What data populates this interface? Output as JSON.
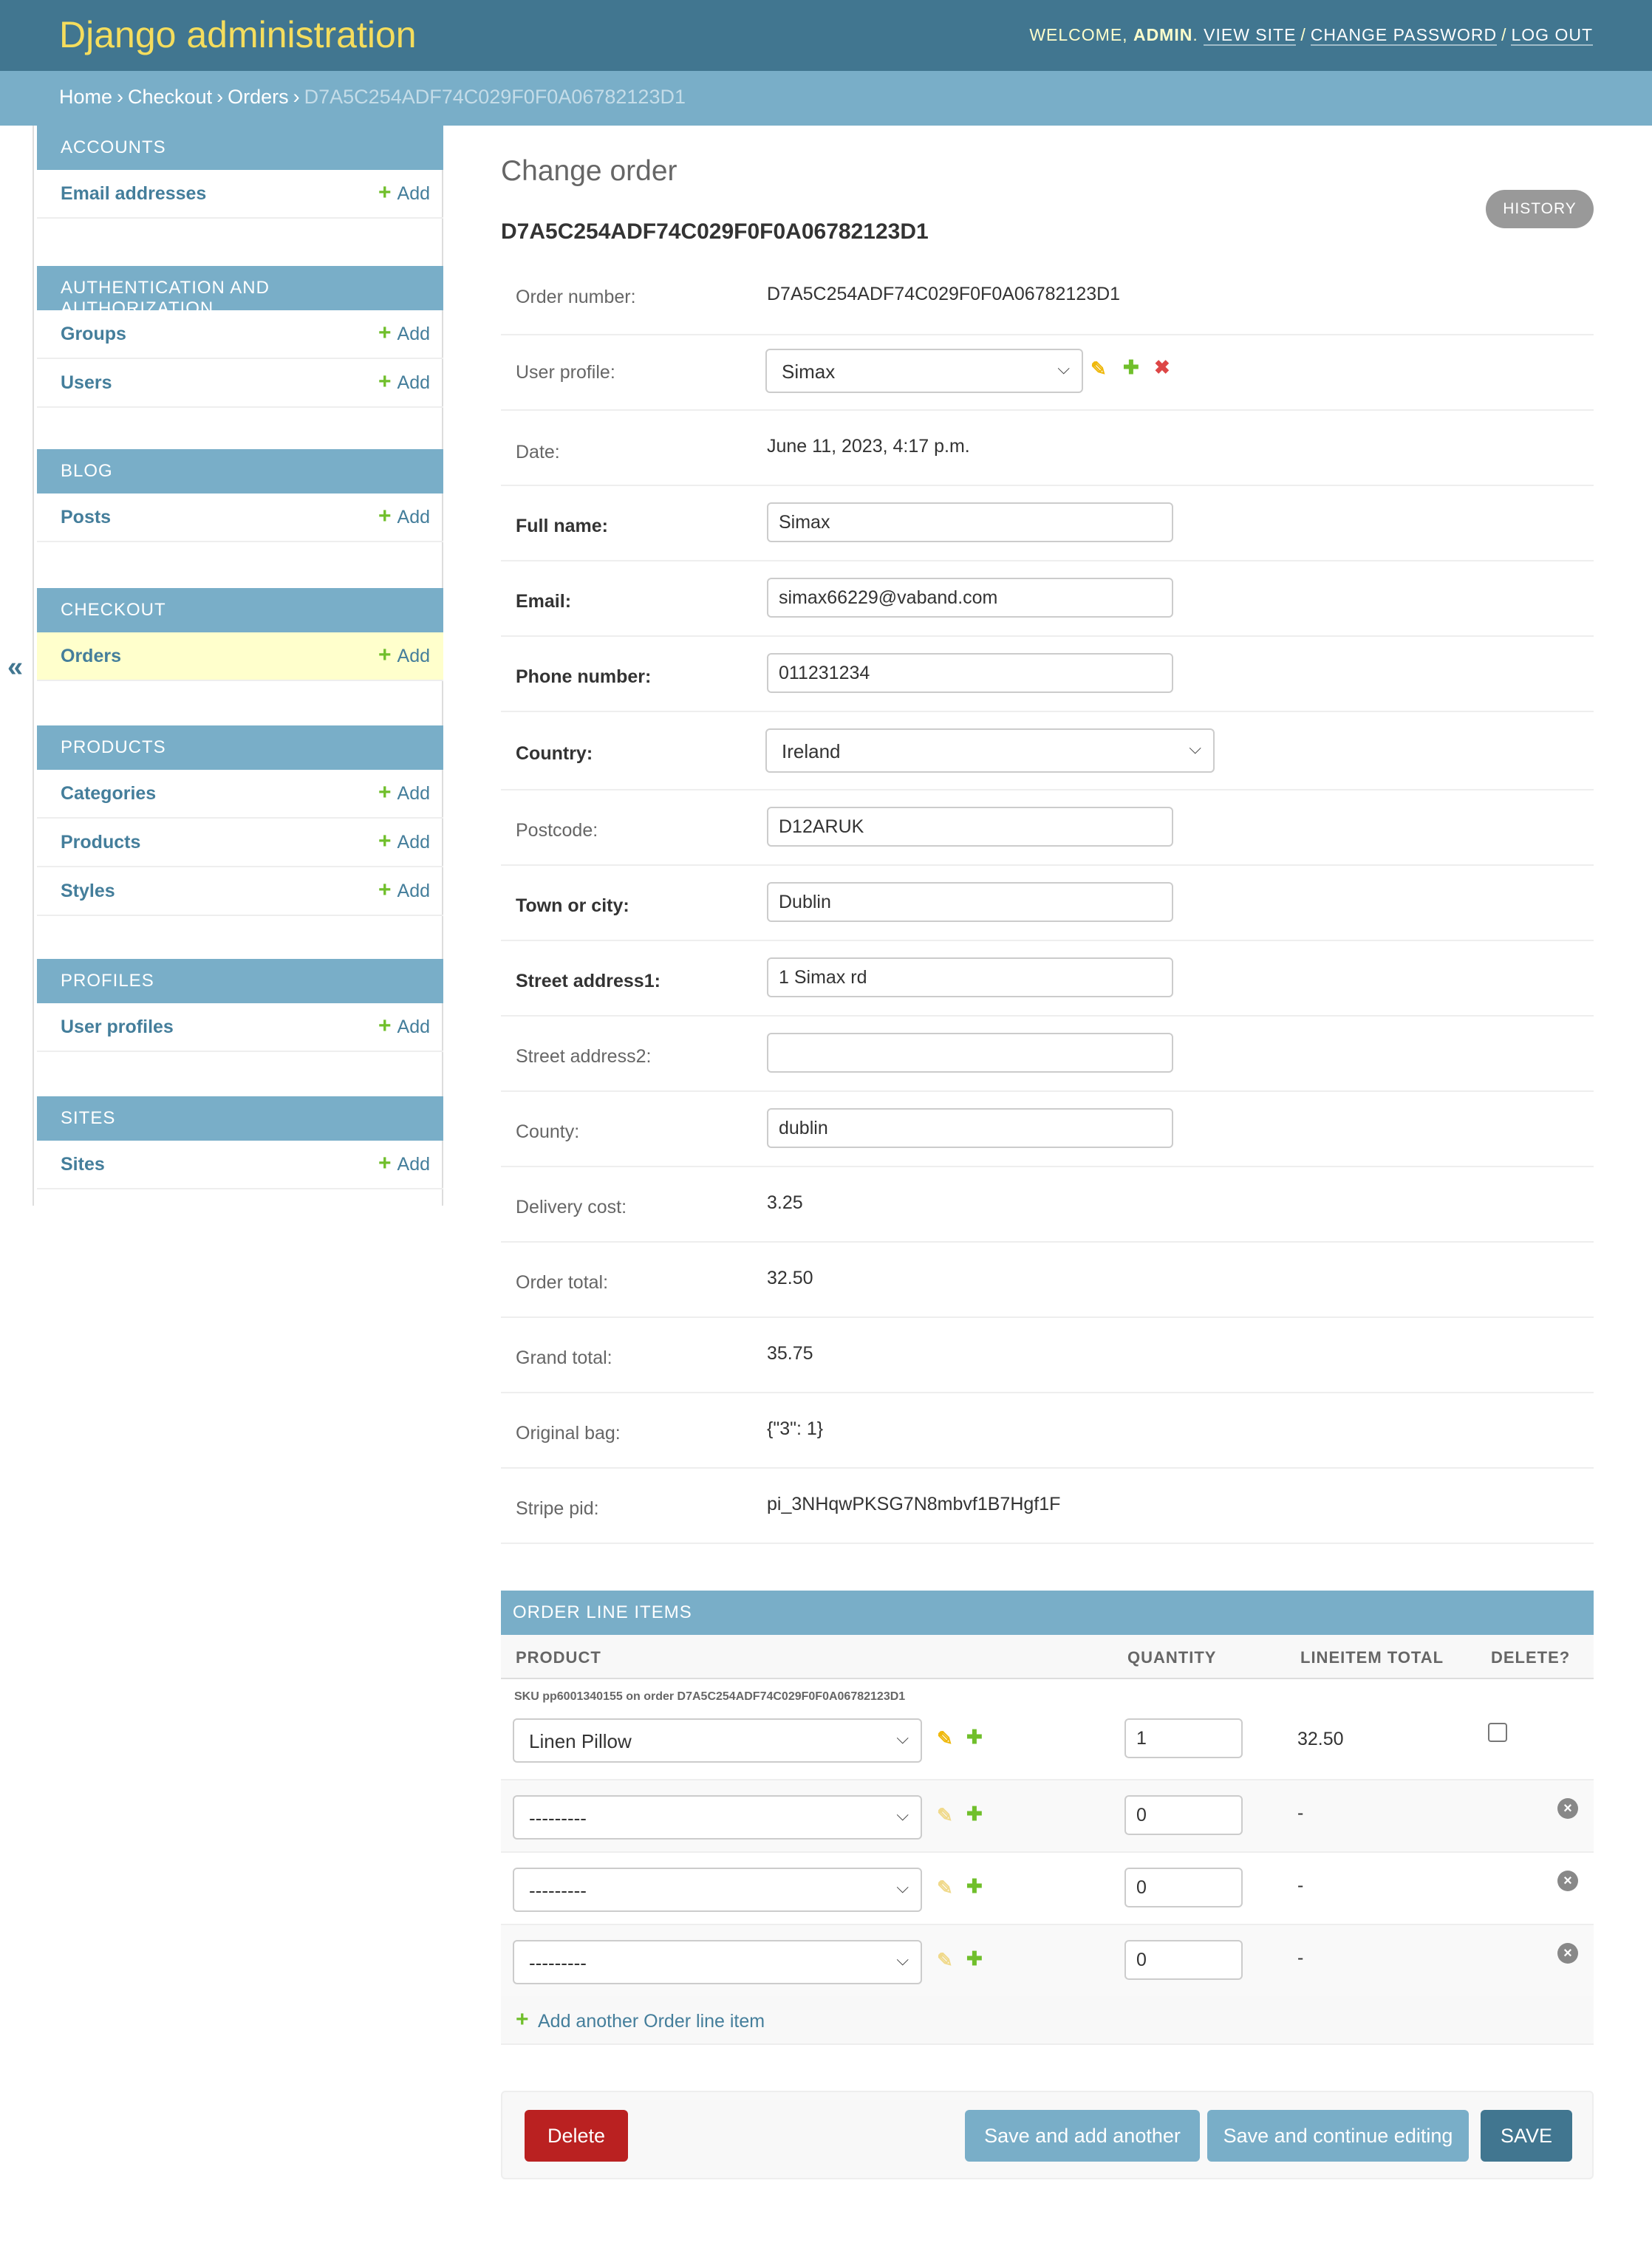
{
  "header": {
    "site_name": "Django administration",
    "welcome": "WELCOME,",
    "username": "ADMIN",
    "view_site": "VIEW SITE",
    "change_password": "CHANGE PASSWORD",
    "log_out": "LOG OUT"
  },
  "breadcrumbs": [
    "Home",
    "Checkout",
    "Orders",
    "D7A5C254ADF74C029F0F0A06782123D1"
  ],
  "sidebar": {
    "toggle": "«",
    "add_label": "Add",
    "apps": [
      {
        "caption": "ACCOUNTS",
        "models": [
          "Email addresses"
        ]
      },
      {
        "caption": "AUTHENTICATION AND AUTHORIZATION",
        "models": [
          "Groups",
          "Users"
        ]
      },
      {
        "caption": "BLOG",
        "models": [
          "Posts"
        ]
      },
      {
        "caption": "CHECKOUT",
        "models": [
          "Orders"
        ]
      },
      {
        "caption": "PRODUCTS",
        "models": [
          "Categories",
          "Products",
          "Styles"
        ]
      },
      {
        "caption": "PROFILES",
        "models": [
          "User profiles"
        ]
      },
      {
        "caption": "SITES",
        "models": [
          "Sites"
        ]
      }
    ]
  },
  "content": {
    "title": "Change order",
    "object_name": "D7A5C254ADF74C029F0F0A06782123D1",
    "history": "HISTORY"
  },
  "fields": [
    {
      "label": "Order number:",
      "value": "D7A5C254ADF74C029F0F0A06782123D1",
      "kind": "text",
      "required": false
    },
    {
      "label": "User profile:",
      "value": "Simax",
      "kind": "select",
      "required": false
    },
    {
      "label": "Date:",
      "value": "June 11, 2023, 4:17 p.m.",
      "kind": "text",
      "required": false
    },
    {
      "label": "Full name:",
      "value": "Simax",
      "kind": "input",
      "required": true
    },
    {
      "label": "Email:",
      "value": "simax66229@vaband.com",
      "kind": "input",
      "required": true
    },
    {
      "label": "Phone number:",
      "value": "011231234",
      "kind": "input",
      "required": true
    },
    {
      "label": "Country:",
      "value": "Ireland",
      "kind": "select",
      "required": true
    },
    {
      "label": "Postcode:",
      "value": "D12ARUK",
      "kind": "input",
      "required": false
    },
    {
      "label": "Town or city:",
      "value": "Dublin",
      "kind": "input",
      "required": true
    },
    {
      "label": "Street address1:",
      "value": "1 Simax rd",
      "kind": "input",
      "required": true
    },
    {
      "label": "Street address2:",
      "value": "",
      "kind": "input",
      "required": false
    },
    {
      "label": "County:",
      "value": "dublin",
      "kind": "input",
      "required": false
    },
    {
      "label": "Delivery cost:",
      "value": "3.25",
      "kind": "text",
      "required": false
    },
    {
      "label": "Order total:",
      "value": "32.50",
      "kind": "text",
      "required": false
    },
    {
      "label": "Grand total:",
      "value": "35.75",
      "kind": "text",
      "required": false
    },
    {
      "label": "Original bag:",
      "value": "{\"3\": 1}",
      "kind": "text",
      "required": false
    },
    {
      "label": "Stripe pid:",
      "value": "pi_3NHqwPKSG7N8mbvf1B7Hgf1F",
      "kind": "text",
      "required": false
    }
  ],
  "inline": {
    "caption": "ORDER LINE ITEMS",
    "headers": {
      "product": "PRODUCT",
      "quantity": "QUANTITY",
      "total": "LINEITEM TOTAL",
      "delete": "DELETE?"
    },
    "sku_label": "SKU pp6001340155 on order D7A5C254ADF74C029F0F0A06782123D1",
    "rows": [
      {
        "product": "Linen Pillow",
        "quantity": "1",
        "total": "32.50",
        "existing": true
      },
      {
        "product": "---------",
        "quantity": "0",
        "total": "-",
        "existing": false
      },
      {
        "product": "---------",
        "quantity": "0",
        "total": "-",
        "existing": false
      },
      {
        "product": "---------",
        "quantity": "0",
        "total": "-",
        "existing": false
      }
    ],
    "add_another": "Add another Order line item"
  },
  "submit": {
    "delete": "Delete",
    "save_add": "Save and add another",
    "save_continue": "Save and continue editing",
    "save": "SAVE"
  },
  "colors": {
    "header_bg": "#417690",
    "breadcrumb_bg": "#79aec8",
    "site_name": "#f5dd5d",
    "add_plus": "#70bf2b",
    "delete_red": "#ba2121",
    "active_row": "#ffffcc"
  }
}
